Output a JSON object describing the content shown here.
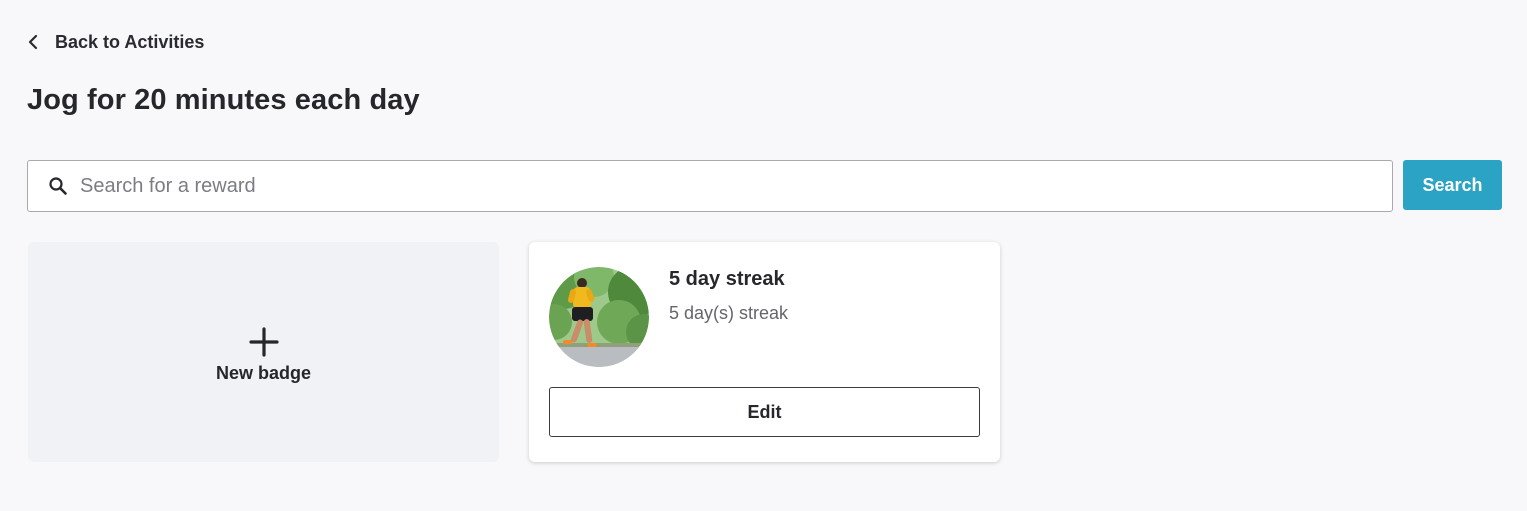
{
  "nav": {
    "back_label": "Back to Activities",
    "back_icon": "chevron-left-icon"
  },
  "page": {
    "title": "Jog for 20 minutes each day"
  },
  "search": {
    "placeholder": "Search for a reward",
    "value": "",
    "button_label": "Search",
    "icon": "search-icon"
  },
  "new_badge": {
    "label": "New badge",
    "icon": "plus-icon"
  },
  "badges": [
    {
      "title": "5 day streak",
      "description": "5 day(s) streak",
      "image": "runner-photo",
      "edit_label": "Edit"
    }
  ],
  "colors": {
    "accent": "#2aa3c4",
    "background": "#f8f8fa",
    "text": "#26272b",
    "muted_text": "#64666c"
  }
}
